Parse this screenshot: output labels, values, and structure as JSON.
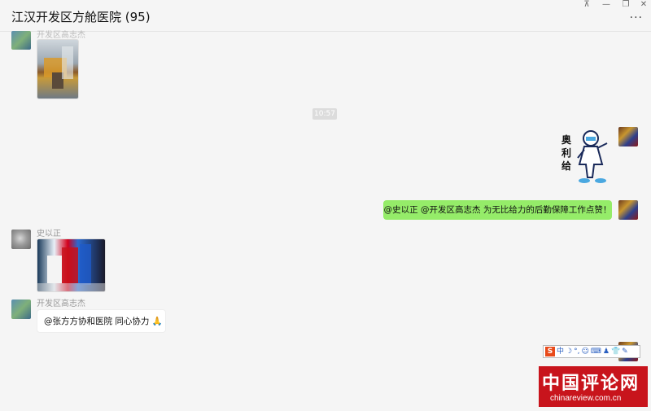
{
  "window": {
    "title": "江汉开发区方舱医院 (95)",
    "controls": {
      "pin": "⊼",
      "minimize": "—",
      "restore": "❐",
      "close": "✕"
    },
    "more": "···"
  },
  "messages": {
    "sender_top": "开发区高志杰",
    "timestamp": "10:57",
    "sticker_text": "奥利给",
    "my_message": "@史以正 @开发区高志杰 为无比给力的后勤保障工作点赞！",
    "sender_shi": "史以正",
    "sender_gao": "开发区高志杰",
    "gao_message": "@张方方协和医院 同心协力",
    "gao_emoji": "🙏"
  },
  "ime_toolbar": {
    "logo": "S",
    "mode": "中",
    "items": [
      "☽",
      "°,",
      "☺",
      "⌨",
      "♟",
      "👕",
      "✎"
    ]
  },
  "watermark": {
    "title": "中国评论网",
    "url": "chinareview.com.cn"
  },
  "colors": {
    "background": "#f5f5f5",
    "my_bubble": "#95ec69",
    "other_bubble": "#ffffff",
    "watermark_bg": "#c8141c"
  }
}
